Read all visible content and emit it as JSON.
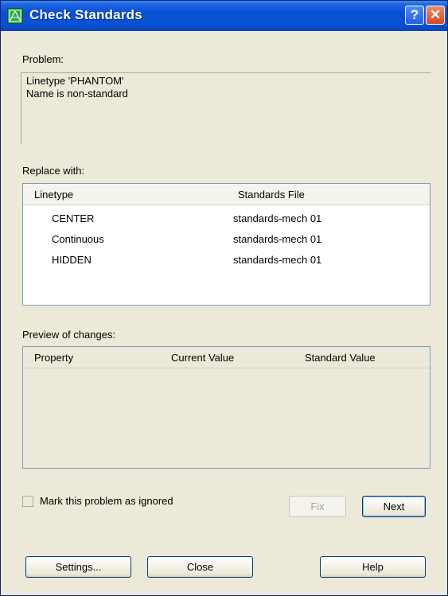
{
  "window": {
    "title": "Check Standards",
    "help_button": "?",
    "close_button": "✕"
  },
  "problem": {
    "label": "Problem:",
    "line1": "Linetype 'PHANTOM'",
    "line2": "Name is non-standard"
  },
  "replace": {
    "label": "Replace with:",
    "columns": [
      "Linetype",
      "Standards File"
    ],
    "rows": [
      {
        "name": "CENTER",
        "file": "standards-mech 01"
      },
      {
        "name": "Continuous",
        "file": "standards-mech 01"
      },
      {
        "name": "HIDDEN",
        "file": "standards-mech 01"
      }
    ]
  },
  "preview": {
    "label": "Preview of changes:",
    "columns": [
      "Property",
      "Current Value",
      "Standard Value"
    ]
  },
  "ignore": {
    "label": "Mark this problem as ignored",
    "checked": false
  },
  "buttons": {
    "fix": "Fix",
    "next": "Next",
    "settings": "Settings...",
    "close": "Close",
    "help": "Help"
  }
}
